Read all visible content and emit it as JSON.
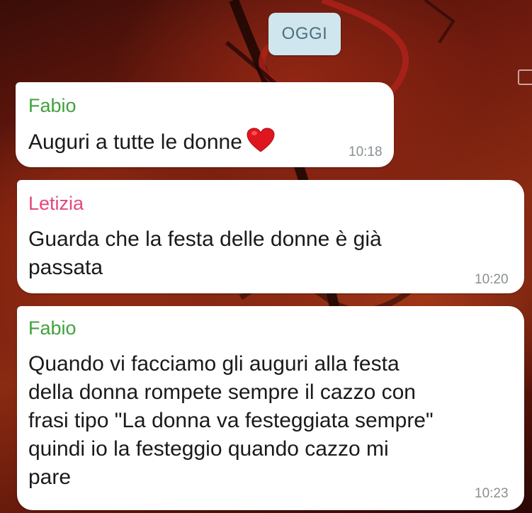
{
  "date_chip": {
    "label": "OGGI"
  },
  "colors": {
    "fabio_name": "#3fa33a",
    "letizia_name": "#e5477a",
    "bubble_bg": "#ffffff",
    "date_chip_bg": "#cfe6ee",
    "timestamp": "#8a8f93"
  },
  "messages": [
    {
      "sender": "Fabio",
      "text": "Auguri a tutte le donne",
      "emoji": "red-heart",
      "time": "10:18"
    },
    {
      "sender": "Letizia",
      "text": "Guarda che la festa delle donne è già\npassata",
      "time": "10:20"
    },
    {
      "sender": "Fabio",
      "text": "Quando vi facciamo gli auguri alla festa\ndella donna rompete sempre il cazzo con\nfrasi tipo \"La donna va festeggiata sempre\"\nquindi io la festeggio quando cazzo mi\npare",
      "time": "10:23"
    }
  ]
}
